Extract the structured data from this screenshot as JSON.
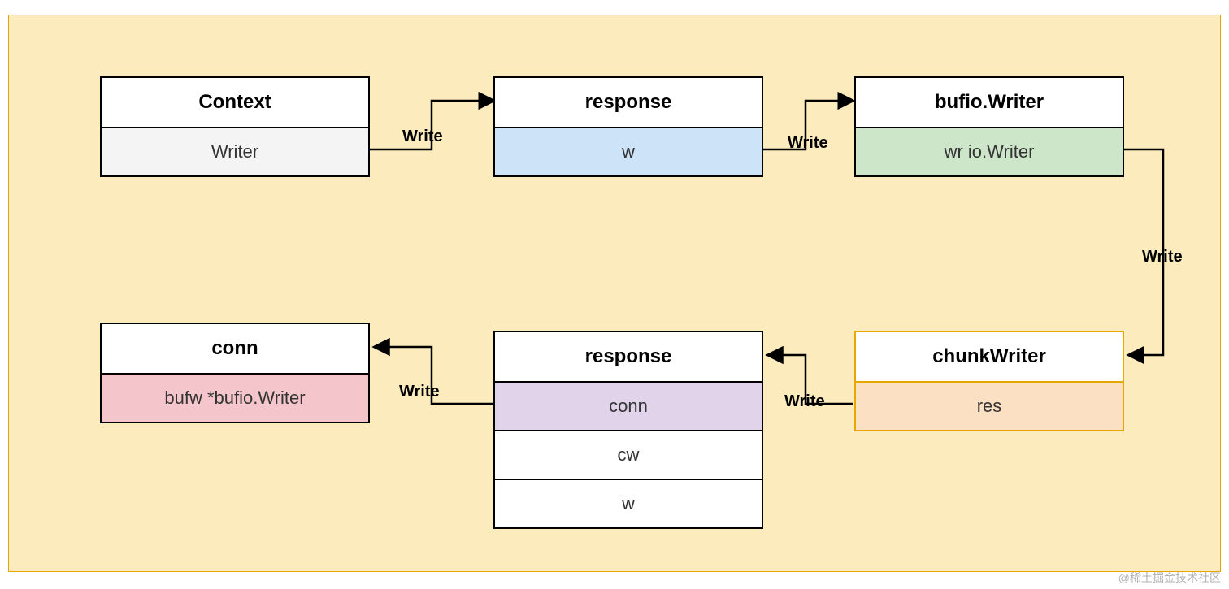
{
  "boxes": {
    "context": {
      "title": "Context",
      "fields": [
        "Writer"
      ]
    },
    "response1": {
      "title": "response",
      "fields": [
        "w"
      ]
    },
    "bufioWriter": {
      "title": "bufio.Writer",
      "fields": [
        "wr io.Writer"
      ]
    },
    "chunkWriter": {
      "title": "chunkWriter",
      "fields": [
        "res"
      ]
    },
    "response2": {
      "title": "response",
      "fields": [
        "conn",
        "cw",
        "w"
      ]
    },
    "conn": {
      "title": "conn",
      "fields": [
        "bufw *bufio.Writer"
      ]
    }
  },
  "edgeLabels": {
    "e1": "Write",
    "e2": "Write",
    "e3": "Write",
    "e4": "Write",
    "e5": "Write"
  },
  "colors": {
    "canvasBg": "#fcebbc",
    "grayFill": "#f4f4f4",
    "blueFill": "#cde3f8",
    "greenFill": "#cde6ca",
    "orangeFill": "#fbe0c3",
    "purpleFill": "#e1d3ea",
    "redFill": "#f4c6cb",
    "orangeBorder": "#e6a800"
  },
  "watermark": "@稀土掘金技术社区"
}
